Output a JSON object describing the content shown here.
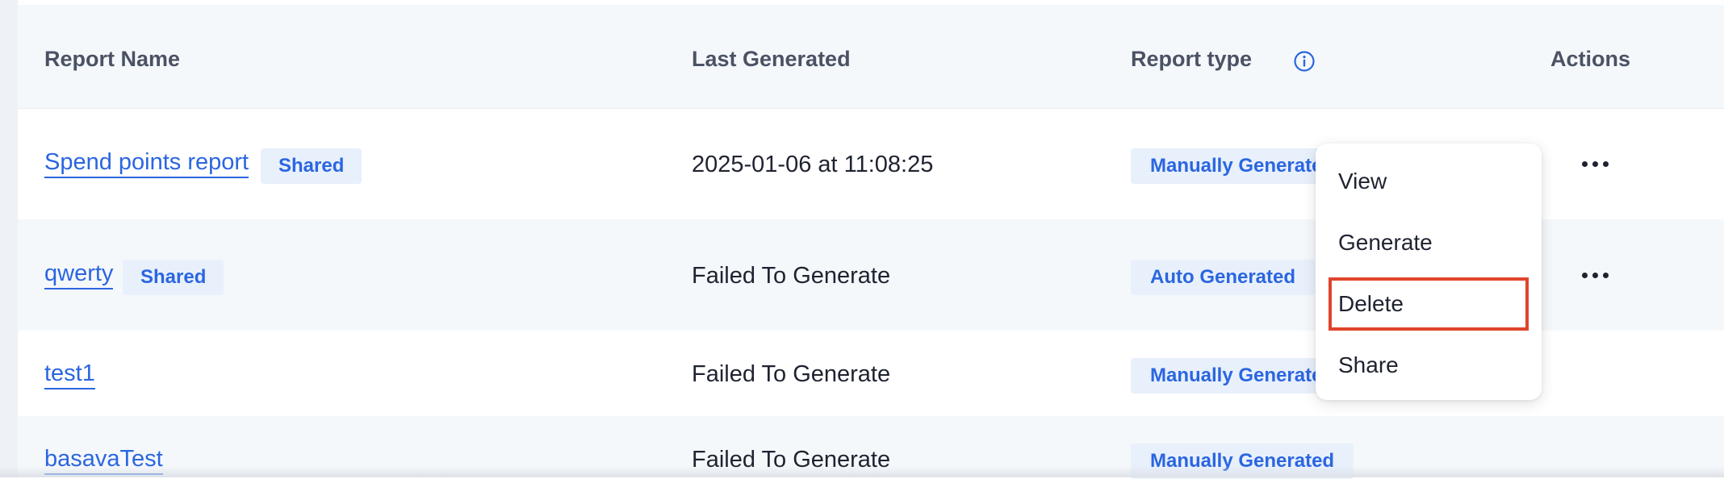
{
  "table": {
    "headers": {
      "report_name": "Report Name",
      "last_generated": "Last Generated",
      "report_type": "Report type",
      "actions": "Actions"
    },
    "rows": [
      {
        "name": "Spend points report",
        "shared_label": "Shared",
        "last_generated": "2025-01-06 at 11:08:25",
        "report_type": "Manually Generated"
      },
      {
        "name": "qwerty",
        "shared_label": "Shared",
        "last_generated": "Failed To Generate",
        "report_type": "Auto Generated"
      },
      {
        "name": "test1",
        "last_generated": "Failed To Generate",
        "report_type": "Manually Generated"
      },
      {
        "name": "basavaTest",
        "last_generated": "Failed To Generate",
        "report_type": "Manually Generated"
      }
    ]
  },
  "actions_menu": {
    "items": [
      "View",
      "Generate",
      "Delete",
      "Share"
    ],
    "highlighted": "Delete"
  },
  "icons": {
    "report_type_info": "info-icon",
    "row_actions": "more-horizontal-icon"
  },
  "colors": {
    "link": "#2b66e0",
    "badge_background": "#e8f0fc",
    "header_background": "#f5f8fb",
    "highlight_border": "#e0442b"
  }
}
